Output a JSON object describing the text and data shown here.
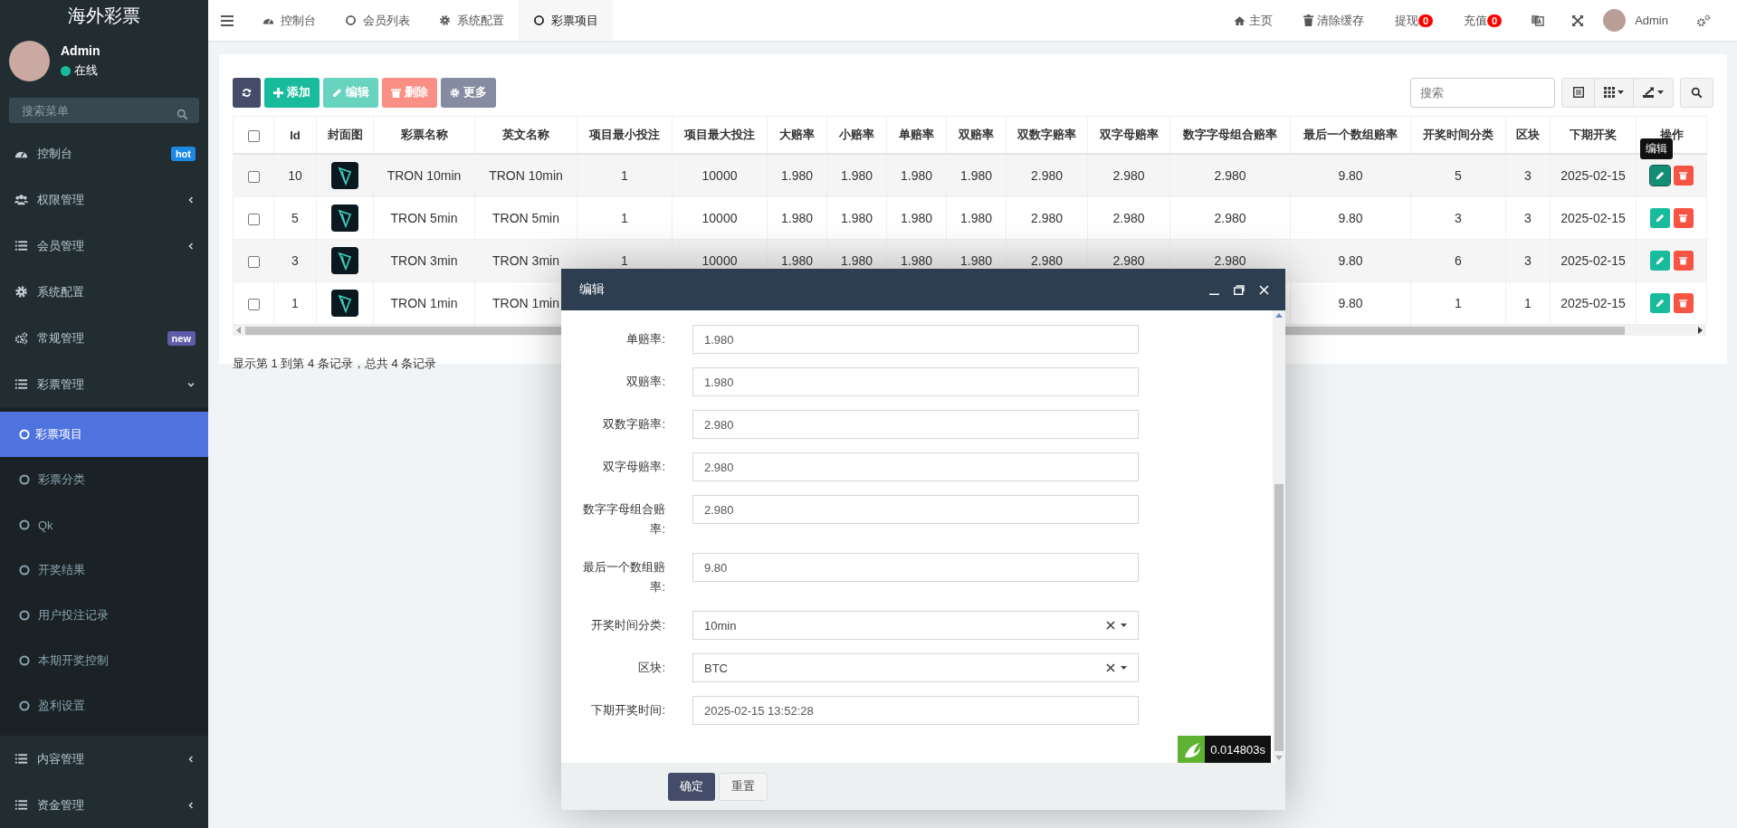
{
  "sidebar": {
    "logo": "海外彩票",
    "user": {
      "name": "Admin",
      "status": "在线",
      "online": true
    },
    "search": {
      "placeholder": "搜索菜单"
    },
    "menu": [
      {
        "kind": "link",
        "label": "控制台",
        "selected": false,
        "badge": {
          "text": "hot",
          "color": "#1e88e5"
        }
      },
      {
        "kind": "group",
        "label": "权限管理",
        "selected": false,
        "expanded": false
      },
      {
        "kind": "group",
        "label": "会员管理",
        "selected": false,
        "expanded": false
      },
      {
        "kind": "link",
        "label": "系统配置",
        "selected": false
      },
      {
        "kind": "link",
        "label": "常规管理",
        "selected": false,
        "badge": {
          "text": "new",
          "color": "#605ca8"
        }
      },
      {
        "kind": "group",
        "label": "彩票管理",
        "selected": false,
        "expanded": true,
        "children": [
          {
            "label": "彩票项目",
            "selected": true
          },
          {
            "label": "彩票分类",
            "selected": false
          },
          {
            "label": "Qk",
            "selected": false
          },
          {
            "label": "开奖结果",
            "selected": false
          },
          {
            "label": "用户投注记录",
            "selected": false
          },
          {
            "label": "本期开奖控制",
            "selected": false
          },
          {
            "label": "盈利设置",
            "selected": false
          }
        ]
      },
      {
        "kind": "group",
        "label": "内容管理",
        "selected": false,
        "expanded": false
      },
      {
        "kind": "group",
        "label": "资金管理",
        "selected": false,
        "expanded": false
      }
    ]
  },
  "header": {
    "tabs": [
      {
        "label": "控制台",
        "selected": false
      },
      {
        "label": "会员列表",
        "selected": false
      },
      {
        "label": "系统配置",
        "selected": false
      },
      {
        "label": "彩票项目",
        "selected": true
      }
    ],
    "links": [
      {
        "label": "主页"
      },
      {
        "label": "清除缓存"
      },
      {
        "label": "提现",
        "badge": "0"
      },
      {
        "label": "充值",
        "badge": "0"
      }
    ],
    "user": "Admin"
  },
  "toolbar": {
    "buttons": [
      {
        "kind": "primary",
        "disabled": false
      },
      {
        "kind": "success",
        "label": "添加",
        "disabled": false
      },
      {
        "kind": "success",
        "label": "编辑",
        "disabled": true
      },
      {
        "kind": "danger",
        "label": "删除",
        "disabled": true
      },
      {
        "kind": "info",
        "label": "更多",
        "disabled": false
      }
    ],
    "search": {
      "placeholder": "搜索"
    }
  },
  "table": {
    "select_all": false,
    "tooltip": "编辑",
    "columns": [
      {
        "kind": "check"
      },
      {
        "kind": "text",
        "label": "Id"
      },
      {
        "kind": "image",
        "label": "封面图"
      },
      {
        "kind": "text",
        "label": "彩票名称"
      },
      {
        "kind": "text",
        "label": "英文名称"
      },
      {
        "kind": "text",
        "label": "项目最小投注"
      },
      {
        "kind": "text",
        "label": "项目最大投注"
      },
      {
        "kind": "text",
        "label": "大赔率"
      },
      {
        "kind": "text",
        "label": "小赔率"
      },
      {
        "kind": "text",
        "label": "单赔率"
      },
      {
        "kind": "text",
        "label": "双赔率"
      },
      {
        "kind": "text",
        "label": "双数字赔率"
      },
      {
        "kind": "text",
        "label": "双字母赔率"
      },
      {
        "kind": "text",
        "label": "数字字母组合赔率"
      },
      {
        "kind": "text",
        "label": "最后一个数组赔率"
      },
      {
        "kind": "text",
        "label": "开奖时间分类"
      },
      {
        "kind": "text",
        "label": "区块"
      },
      {
        "kind": "text",
        "label": "下期开奖"
      },
      {
        "kind": "actions",
        "label": "操作"
      }
    ],
    "rows": [
      {
        "selected": false,
        "edit_focused": true,
        "cells": [
          "",
          "10",
          "",
          "TRON 10min",
          "TRON 10min",
          "1",
          "10000",
          "1.980",
          "1.980",
          "1.980",
          "1.980",
          "2.980",
          "2.980",
          "2.980",
          "9.80",
          "5",
          "3",
          "2025-02-15",
          ""
        ]
      },
      {
        "selected": false,
        "edit_focused": false,
        "cells": [
          "",
          "5",
          "",
          "TRON 5min",
          "TRON 5min",
          "1",
          "10000",
          "1.980",
          "1.980",
          "1.980",
          "1.980",
          "2.980",
          "2.980",
          "2.980",
          "9.80",
          "3",
          "3",
          "2025-02-15",
          ""
        ]
      },
      {
        "selected": false,
        "edit_focused": false,
        "cells": [
          "",
          "3",
          "",
          "TRON 3min",
          "TRON 3min",
          "1",
          "10000",
          "1.980",
          "1.980",
          "1.980",
          "1.980",
          "2.980",
          "2.980",
          "2.980",
          "9.80",
          "6",
          "3",
          "2025-02-15",
          ""
        ]
      },
      {
        "selected": false,
        "edit_focused": false,
        "cells": [
          "",
          "1",
          "",
          "TRON 1min",
          "TRON 1min",
          "",
          "",
          "",
          "",
          "",
          "",
          "",
          "",
          "",
          "9.80",
          "1",
          "1",
          "2025-02-15",
          ""
        ]
      }
    ]
  },
  "pagination": {
    "summary": "显示第 1 到第 4 条记录，总共 4 条记录"
  },
  "dialog": {
    "title": "编辑",
    "timer": "0.014803s",
    "fields": [
      {
        "kind": "input",
        "label": "单赔率:",
        "value": "1.980"
      },
      {
        "kind": "input",
        "label": "双赔率:",
        "value": "1.980"
      },
      {
        "kind": "input",
        "label": "双数字赔率:",
        "value": "2.980"
      },
      {
        "kind": "input",
        "label": "双字母赔率:",
        "value": "2.980"
      },
      {
        "kind": "input",
        "label": "数字字母组合赔率:",
        "value": "2.980"
      },
      {
        "kind": "input",
        "label": "最后一个数组赔率:",
        "value": "9.80"
      },
      {
        "kind": "select",
        "label": "开奖时间分类:",
        "value": "10min"
      },
      {
        "kind": "select",
        "label": "区块:",
        "value": "BTC"
      },
      {
        "kind": "input",
        "label": "下期开奖时间:",
        "value": "2025-02-15 13:52:28"
      }
    ],
    "buttons": [
      {
        "kind": "primary",
        "label": "确定"
      },
      {
        "kind": "default",
        "label": "重置"
      }
    ]
  }
}
